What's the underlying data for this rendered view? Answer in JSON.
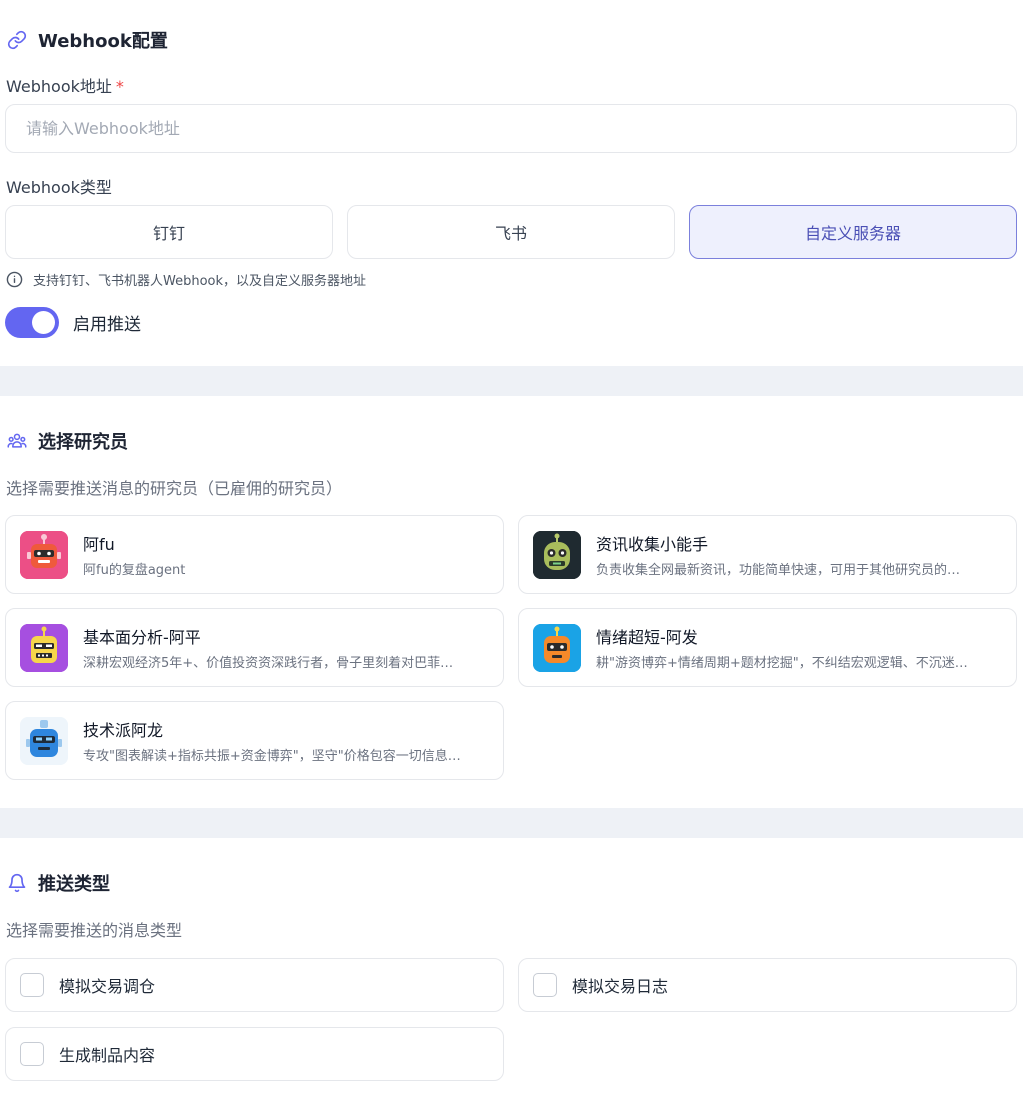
{
  "webhook_section": {
    "title": "Webhook配置",
    "address_label": "Webhook地址",
    "required_mark": "*",
    "address_value": "",
    "address_placeholder": "请输入Webhook地址",
    "type_label": "Webhook类型",
    "types": [
      {
        "label": "钉钉",
        "selected": false
      },
      {
        "label": "飞书",
        "selected": false
      },
      {
        "label": "自定义服务器",
        "selected": true
      }
    ],
    "hint": "支持钉钉、飞书机器人Webhook，以及自定义服务器地址",
    "toggle_label": "启用推送",
    "toggle_on": true,
    "accent_color": "#6366f1"
  },
  "researcher_section": {
    "title": "选择研究员",
    "description": "选择需要推送消息的研究员（已雇佣的研究员）",
    "researchers": [
      {
        "name": "阿fu",
        "desc": "阿fu的复盘agent",
        "avatar": "pink-robot-icon"
      },
      {
        "name": "资讯收集小能手",
        "desc": "负责收集全网最新资讯，功能简单快速，可用于其他研究员的…",
        "avatar": "dark-robot-icon"
      },
      {
        "name": "基本面分析-阿平",
        "desc": "深耕宏观经济5年+、价值投资资深践行者，骨子里刻着对巴菲…",
        "avatar": "purple-yellow-robot-icon"
      },
      {
        "name": "情绪超短-阿发",
        "desc": "耕\"游资博弈+情绪周期+题材挖掘\"，不纠结宏观逻辑、不沉迷…",
        "avatar": "blue-orange-robot-icon"
      },
      {
        "name": "技术派阿龙",
        "desc": "专攻\"图表解读+指标共振+资金博弈\"，坚守\"价格包容一切信息…",
        "avatar": "blue-robot-icon"
      }
    ]
  },
  "push_section": {
    "title": "推送类型",
    "description": "选择需要推送的消息类型",
    "options": [
      {
        "label": "模拟交易调仓",
        "checked": false
      },
      {
        "label": "模拟交易日志",
        "checked": false
      },
      {
        "label": "生成制品内容",
        "checked": false
      }
    ]
  }
}
